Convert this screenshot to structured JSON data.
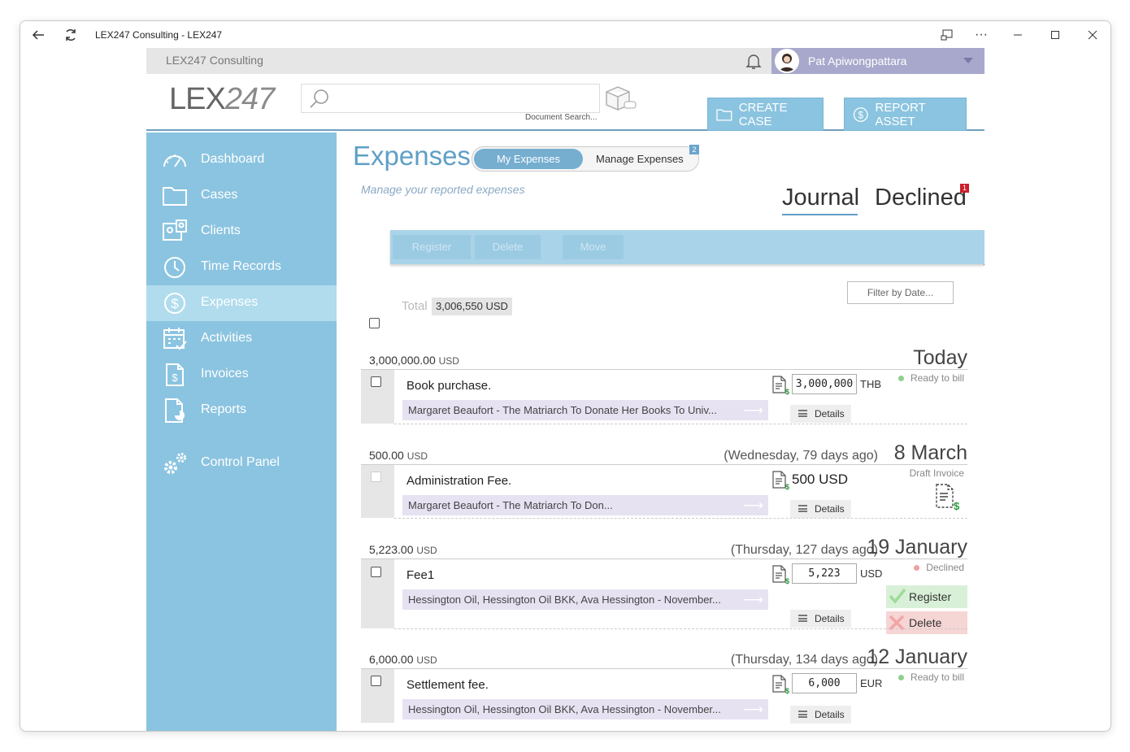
{
  "window": {
    "title": "LEX247 Consulting - LEX247"
  },
  "topbar": {
    "firm": "LEX247 Consulting",
    "user": "Pat Apiwongpattara"
  },
  "header": {
    "logo_bold": "LEX",
    "logo_thin": "247",
    "search_placeholder": "",
    "doc_search_label": "Document Search...",
    "create_case": "CREATE CASE",
    "report_asset": "REPORT ASSET"
  },
  "sidebar": {
    "items": [
      {
        "label": "Dashboard",
        "icon": "dashboard-icon"
      },
      {
        "label": "Cases",
        "icon": "folder-icon"
      },
      {
        "label": "Clients",
        "icon": "clients-icon"
      },
      {
        "label": "Time Records",
        "icon": "clock-icon"
      },
      {
        "label": "Expenses",
        "icon": "dollar-icon"
      },
      {
        "label": "Activities",
        "icon": "calendar-icon"
      },
      {
        "label": "Invoices",
        "icon": "invoice-icon"
      },
      {
        "label": "Reports",
        "icon": "report-icon"
      },
      {
        "label": "Control Panel",
        "icon": "gears-icon"
      }
    ],
    "active": "Expenses"
  },
  "page": {
    "title": "Expenses",
    "seg_on": "My Expenses",
    "seg_off": "Manage Expenses",
    "seg_badge": "2",
    "subtitle": "Manage your reported expenses",
    "tab_journal": "Journal",
    "tab_declined": "Declined",
    "declined_badge": "1"
  },
  "toolbar": {
    "register": "Register",
    "delete": "Delete",
    "move": "Move"
  },
  "filter": "Filter by Date...",
  "total": {
    "label": "Total",
    "value": "3,006,550 USD"
  },
  "groups": [
    {
      "amount": "3,000,000.00",
      "currency": "USD",
      "relative": "",
      "date": "Today",
      "title": "Book purchase.",
      "case": "Margaret Beaufort - The Matriarch To Donate Her Books To Univ...",
      "amount_box": "3,000,000",
      "amount_cur": "THB",
      "status": "Ready to bill",
      "details": "Details"
    },
    {
      "amount": "500.00",
      "currency": "USD",
      "relative": "(Wednesday, 79 days ago)",
      "date": "8 March",
      "title": "Administration Fee.",
      "case": "Margaret Beaufort - The Matriarch To Don...",
      "amount_plain": "500 USD",
      "status": "Draft Invoice",
      "details": "Details"
    },
    {
      "amount": "5,223.00",
      "currency": "USD",
      "relative": "(Thursday, 127 days ago)",
      "date": "19 January",
      "title": "Fee1",
      "case": "Hessington Oil, Hessington Oil BKK, Ava Hessington - November...",
      "amount_box": "5,223",
      "amount_cur": "USD",
      "status": "Declined",
      "action_register": "Register",
      "action_delete": "Delete",
      "details": "Details"
    },
    {
      "amount": "6,000.00",
      "currency": "USD",
      "relative": "(Thursday, 134 days ago)",
      "date": "12 January",
      "title": "Settlement fee.",
      "case": "Hessington Oil, Hessington Oil BKK, Ava Hessington - November...",
      "amount_box": "6,000",
      "amount_cur": "EUR",
      "status": "Ready to bill",
      "details": "Details"
    }
  ],
  "colors": {
    "sidebar": "#8bc4e0",
    "active": "#b0dced",
    "accent": "#5f9fc6",
    "ready": "#8fcf8f",
    "declined": "#f0a0a0"
  }
}
